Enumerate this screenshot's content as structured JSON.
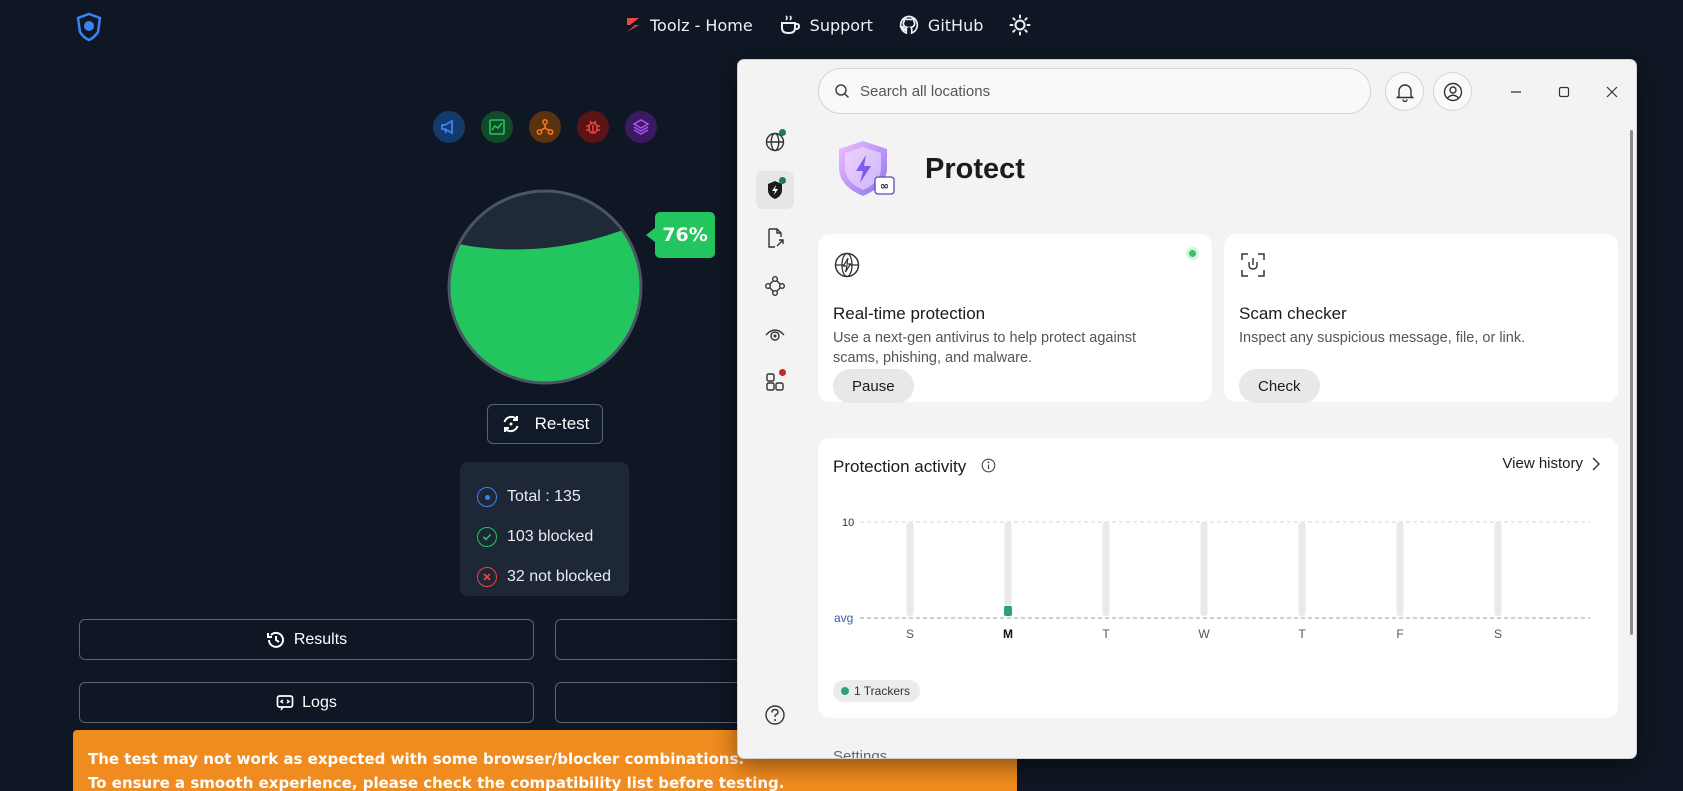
{
  "topnav": {
    "items": [
      {
        "label": "Toolz - Home",
        "icon": "toolz-logo-icon"
      },
      {
        "label": "Support",
        "icon": "coffee-icon"
      },
      {
        "label": "GitHub",
        "icon": "github-icon"
      }
    ],
    "theme_icon": "sun-icon"
  },
  "test": {
    "percent": "76%",
    "percent_value": 76,
    "retest_label": "Re-test",
    "total": "Total : 135",
    "blocked": "103 blocked",
    "not_blocked": "32 not blocked",
    "results_label": "Results",
    "logs_label": "Logs",
    "warning_line1": "The test may not work as expected with some browser/blocker combinations.",
    "warning_line2": "To ensure a smooth experience, please check the compatibility list before testing."
  },
  "colors": {
    "blocked": "#22c55e",
    "warning": "#f08b1f",
    "accent_teal": "#2f9e83"
  },
  "window": {
    "search_placeholder": "Search all locations",
    "page_title": "Protect",
    "realtime": {
      "title": "Real-time protection",
      "desc": "Use a next-gen antivirus to help protect against scams, phishing, and malware.",
      "button": "Pause"
    },
    "scam": {
      "title": "Scam checker",
      "desc": "Inspect any suspicious message, file, or link.",
      "button": "Check"
    },
    "activity": {
      "title": "Protection activity",
      "view_history": "View history",
      "tracker_tag": "1 Trackers"
    },
    "settings_label": "Settings"
  },
  "chart_data": {
    "type": "bar",
    "categories": [
      "S",
      "M",
      "T",
      "W",
      "T",
      "F",
      "S"
    ],
    "highlight_category_index": 1,
    "series": [
      {
        "name": "Trackers",
        "values": [
          0,
          1,
          0,
          0,
          0,
          0,
          0
        ]
      }
    ],
    "ytick_labels": [
      "avg",
      "10"
    ],
    "ylim": [
      0,
      10
    ],
    "grid": true
  }
}
